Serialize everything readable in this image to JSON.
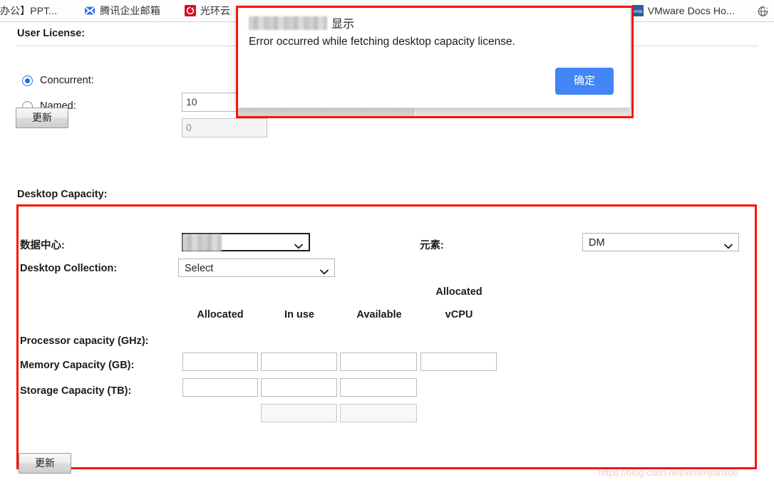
{
  "bookmarks": [
    {
      "label": "办公】PPT...",
      "icon": "none",
      "truncated": true
    },
    {
      "label": "腾讯企业邮箱",
      "icon": "tencent-mail-icon"
    },
    {
      "label": "光环云",
      "icon": "refresh-red-icon"
    },
    {
      "label": "VMware Docs Ho...",
      "icon": "vmware-icon"
    }
  ],
  "toolbar": {
    "overflow_icon": "globe-icon"
  },
  "user_license": {
    "title": "User License:",
    "options": [
      {
        "label": "Concurrent:",
        "selected": true,
        "value": "10",
        "disabled": false
      },
      {
        "label": "Named:",
        "selected": false,
        "value": "0",
        "disabled": true
      }
    ],
    "update_button": "更新"
  },
  "desktop_capacity": {
    "title": "Desktop Capacity:",
    "datacenter": {
      "label": "数据中心:",
      "value": "DC",
      "redacted_prefix": true,
      "focused": true
    },
    "element": {
      "label": "元素:",
      "value": "DM"
    },
    "desktop_collection": {
      "label": "Desktop Collection:",
      "value": "Select"
    },
    "columns": [
      "Allocated",
      "In use",
      "Available",
      "Allocated vCPU"
    ],
    "column_headers": [
      {
        "line1": "",
        "line2": "Allocated"
      },
      {
        "line1": "",
        "line2": "In use"
      },
      {
        "line1": "",
        "line2": "Available"
      },
      {
        "line1": "Allocated",
        "line2": "vCPU"
      }
    ],
    "rows": [
      {
        "label": "Processor capacity (GHz):",
        "cells": [
          {
            "value": "",
            "state": "empty"
          },
          {
            "value": "",
            "state": "empty"
          },
          {
            "value": "",
            "state": "empty"
          },
          {
            "value": "",
            "state": "empty"
          }
        ]
      },
      {
        "label": "Memory Capacity (GB):",
        "cells": [
          {
            "value": "",
            "state": "empty"
          },
          {
            "value": "",
            "state": "empty"
          },
          {
            "value": "",
            "state": "empty"
          },
          {
            "value": "",
            "state": "absent"
          }
        ]
      },
      {
        "label": "Storage Capacity (TB):",
        "cells": [
          {
            "value": "",
            "state": "absent"
          },
          {
            "value": "",
            "state": "greyfill"
          },
          {
            "value": "",
            "state": "greyfill"
          },
          {
            "value": "",
            "state": "absent"
          }
        ]
      }
    ],
    "update_button": "更新"
  },
  "dialog": {
    "title_suffix": "显示",
    "title_redacted": true,
    "message": "Error occurred while fetching desktop capacity license.",
    "ok_button": "确定",
    "accent_color": "#4285f4"
  },
  "annotations": {
    "highlight_color": "#fb1105"
  },
  "watermark": "https://blog.csdn.net/ximenjianxue"
}
